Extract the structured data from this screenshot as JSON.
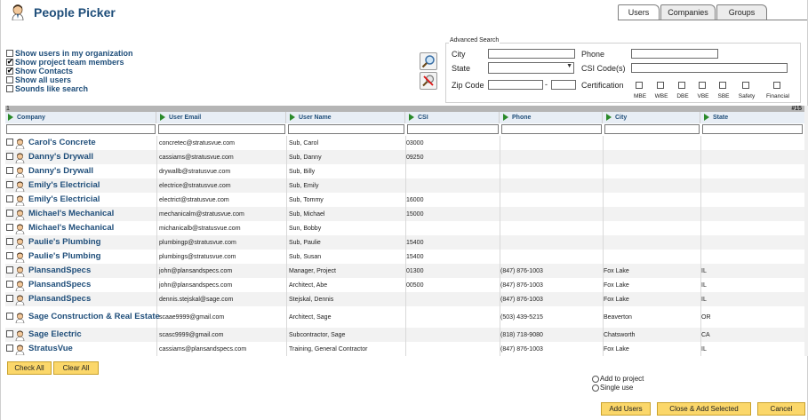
{
  "app": {
    "title": "People Picker"
  },
  "tabs": [
    {
      "label": "Users",
      "active": true
    },
    {
      "label": "Companies",
      "active": false
    },
    {
      "label": "Groups",
      "active": false
    }
  ],
  "options": [
    {
      "label": "Show users in my organization",
      "checked": false
    },
    {
      "label": "Show project team members",
      "checked": true
    },
    {
      "label": "Show Contacts",
      "checked": true
    },
    {
      "label": "Show all users",
      "checked": false
    },
    {
      "label": "Sounds like search",
      "checked": false
    }
  ],
  "advanced": {
    "title": "Advanced Search",
    "city_label": "City",
    "phone_label": "Phone",
    "state_label": "State",
    "csi_label": "CSI Code(s)",
    "zip_label": "Zip Code",
    "zip_sep": "-",
    "cert_label": "Certification",
    "certs": [
      "MBE",
      "WBE",
      "DBE",
      "VBE",
      "SBE",
      "Safety",
      "Financial"
    ]
  },
  "grid": {
    "page": "1",
    "count": "#15",
    "columns": [
      "Company",
      "User Email",
      "User Name",
      "CSI",
      "Phone",
      "City",
      "State"
    ],
    "rows": [
      {
        "company": "Carol's Concrete",
        "email": "concretec@stratusvue.com",
        "name": "Sub, Carol",
        "csi": "03000",
        "phone": "",
        "city": "",
        "state": ""
      },
      {
        "company": "Danny's Drywall",
        "email": "cassiams@stratusvue.com",
        "name": "Sub, Danny",
        "csi": "09250",
        "phone": "",
        "city": "",
        "state": ""
      },
      {
        "company": "Danny's Drywall",
        "email": "drywallb@stratusvue.com",
        "name": "Sub, Billy",
        "csi": "",
        "phone": "",
        "city": "",
        "state": ""
      },
      {
        "company": "Emily's Electricial",
        "email": "electrice@stratusvue.com",
        "name": "Sub, Emily",
        "csi": "",
        "phone": "",
        "city": "",
        "state": ""
      },
      {
        "company": "Emily's Electricial",
        "email": "electrict@stratusvue.com",
        "name": "Sub, Tommy",
        "csi": "16000",
        "phone": "",
        "city": "",
        "state": ""
      },
      {
        "company": "Michael's Mechanical",
        "email": "mechanicalm@stratusvue.com",
        "name": "Sub, Michael",
        "csi": "15000",
        "phone": "",
        "city": "",
        "state": ""
      },
      {
        "company": "Michael's Mechanical",
        "email": "michanicalb@stratusvue.com",
        "name": "Sun, Bobby",
        "csi": "",
        "phone": "",
        "city": "",
        "state": ""
      },
      {
        "company": "Paulie's Plumbing",
        "email": "plumbingp@stratusvue.com",
        "name": "Sub, Paulie",
        "csi": "15400",
        "phone": "",
        "city": "",
        "state": ""
      },
      {
        "company": "Paulie's Plumbing",
        "email": "plumbings@stratusvue.com",
        "name": "Sub, Susan",
        "csi": "15400",
        "phone": "",
        "city": "",
        "state": ""
      },
      {
        "company": "PlansandSpecs",
        "email": "john@plansandspecs.com",
        "name": "Manager, Project",
        "csi": "01300",
        "phone": "(847) 876-1003",
        "city": "Fox Lake",
        "state": "IL"
      },
      {
        "company": "PlansandSpecs",
        "email": "john@plansandspecs.com",
        "name": "Architect, Abe",
        "csi": "00500",
        "phone": "(847) 876-1003",
        "city": "Fox Lake",
        "state": "IL"
      },
      {
        "company": "PlansandSpecs",
        "email": "dennis.stejskal@sage.com",
        "name": "Stejskal, Dennis",
        "csi": "",
        "phone": "(847) 876-1003",
        "city": "Fox Lake",
        "state": "IL"
      },
      {
        "company": "Sage Construction & Real Estate",
        "email": "scaae9999@gmail.com",
        "name": "Architect, Sage",
        "csi": "",
        "phone": "(503) 439-5215",
        "city": "Beaverton",
        "state": "OR"
      },
      {
        "company": "Sage Electric",
        "email": "scasc9999@gmail.com",
        "name": "Subcontractor, Sage",
        "csi": "",
        "phone": "(818) 718-9080",
        "city": "Chatsworth",
        "state": "CA"
      },
      {
        "company": "StratusVue",
        "email": "cassiams@plansandspecs.com",
        "name": "Training, General Contractor",
        "csi": "",
        "phone": "(847) 876-1003",
        "city": "Fox Lake",
        "state": "IL"
      }
    ]
  },
  "buttons": {
    "check_all": "Check All",
    "clear_all": "Clear All",
    "add_users": "Add Users",
    "close_add": "Close & Add Selected",
    "cancel": "Cancel"
  },
  "mode": {
    "add_to_project": "Add to project",
    "single_use": "Single use"
  },
  "colors": {
    "accent": "#1f4e7a",
    "button": "#fbd76a",
    "header_band": "#b5b5b5",
    "arrow": "#2a8a2a"
  }
}
